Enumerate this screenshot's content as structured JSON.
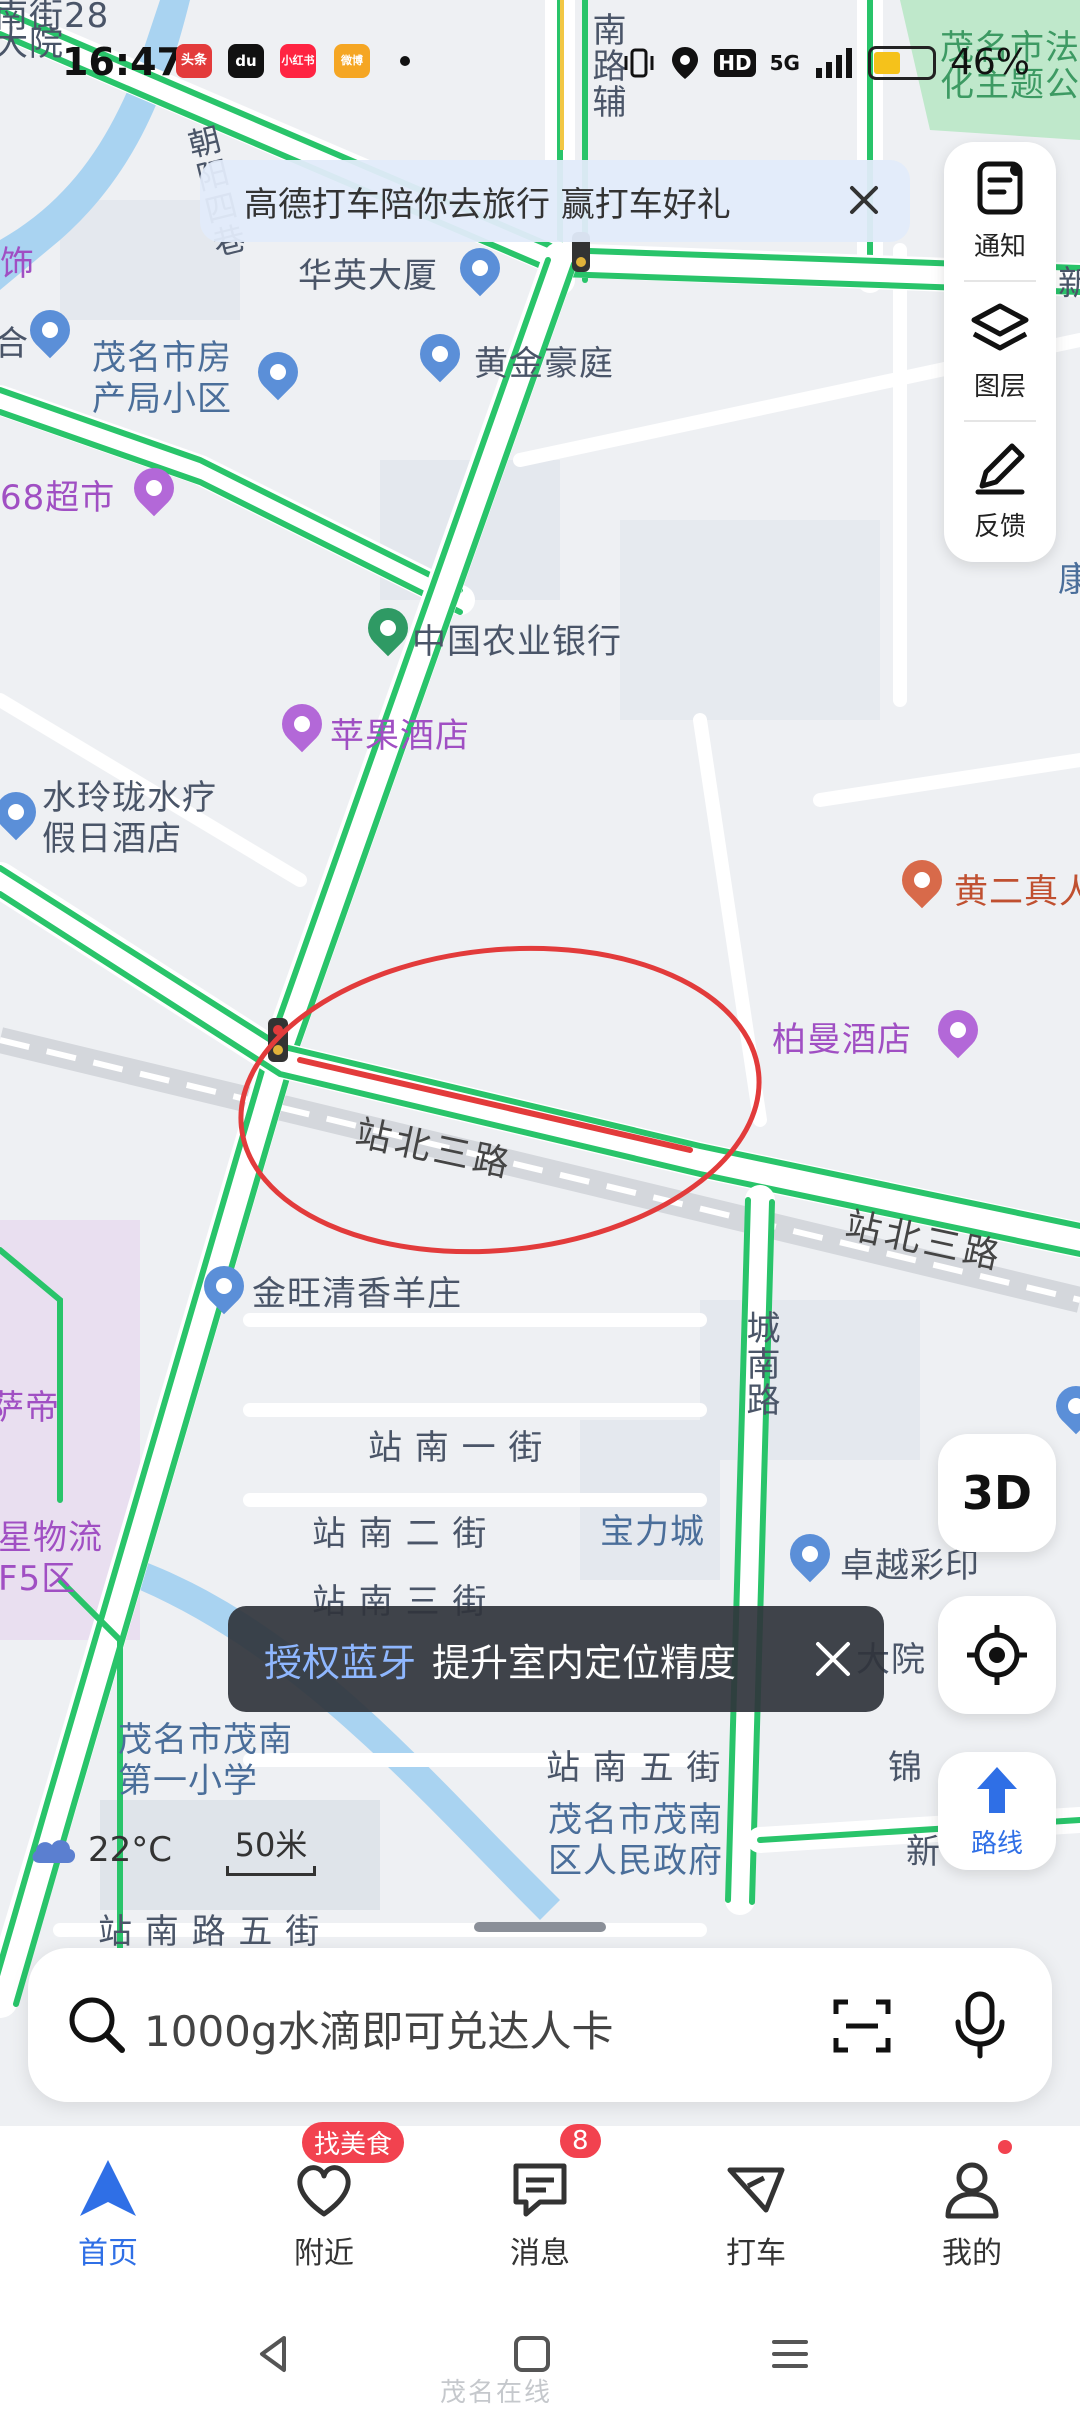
{
  "status_bar": {
    "time": "16:47",
    "apps": [
      "头条",
      "du",
      "小红书",
      "微博"
    ],
    "network": "5G",
    "hd": "HD",
    "battery_percent": "46%",
    "battery_level": 0.46
  },
  "promo": {
    "text": "高德打车陪你去旅行 赢打车好礼"
  },
  "tools": {
    "notify": "通知",
    "layers": "图层",
    "feedback": "反馈"
  },
  "map": {
    "labels": {
      "top_left_road": "南街28",
      "top_left_yard": "大院",
      "chao_yang_si_xiang": "朝阳四巷",
      "nan_lu_fu": "南路辅",
      "huaying": "华英大厦",
      "shi": "饰",
      "he": "合",
      "fangchan": "茂名市房\n产局小区",
      "huangjin": "黄金豪庭",
      "chaoshi": "68超市",
      "nongye": "中国农业银行",
      "pingguo": "苹果酒店",
      "shuilinglong": "水玲珑水疗\n假日酒店",
      "huanger": "黄二真人",
      "baiman": "柏曼酒店",
      "zhanbei_a": "站北三路",
      "zhanbei_b": "站北三路",
      "jinwang": "金旺清香羊庄",
      "chengnan": "城南路",
      "chendi": "萨帝",
      "zhannan1": "站 南 一 街",
      "zhannan2": "站 南 二 街",
      "baolicheng": "宝力城",
      "zhuoyue": "卓越彩印",
      "zhannan3": "站 南 三 街",
      "xingwuliu": "星物流\nF5区",
      "maoming_school": "茂名市茂南\n第一小学",
      "zhannan5": "站 南 五 街",
      "jin": "锦",
      "maoming_gov": "茂名市茂南\n区人民政府",
      "xin": "新",
      "dayuan": "大院",
      "zhannan_lu5": "站 南 路 五 街",
      "top_right": "茂名市法\n化主题公",
      "kang": "康",
      "xin2": "新"
    }
  },
  "controls": {
    "three_d": "3D",
    "route": "路线"
  },
  "toast": {
    "highlight": "授权蓝牙",
    "text": "提升室内定位精度"
  },
  "weather": {
    "temp": "22°C"
  },
  "scale": {
    "value": "50米"
  },
  "search": {
    "placeholder": "1000g水滴即可兑达人卡"
  },
  "bottom_nav": {
    "home": "首页",
    "nearby": "附近",
    "nearby_badge": "找美食",
    "messages": "消息",
    "messages_badge": "8",
    "taxi": "打车",
    "mine": "我的"
  },
  "colors": {
    "accent": "#2f6fe6",
    "road_green": "#29c46a",
    "annotation_red": "#e23b3b",
    "badge_red": "#f2424f"
  },
  "watermark": "茂名在线"
}
